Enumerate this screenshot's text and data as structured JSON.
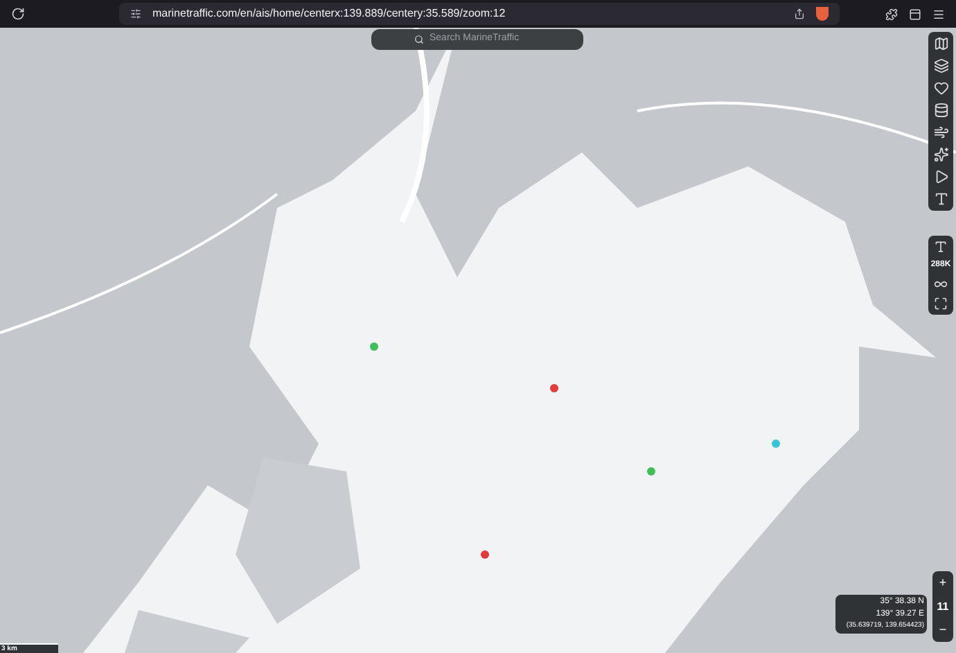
{
  "browser": {
    "url": "marinetraffic.com/en/ais/home/centerx:139.889/centery:35.589/zoom:12"
  },
  "map": {
    "kind": "picture",
    "search": {
      "placeholder": "Search MarineTraffic"
    },
    "vessel_count": "288K",
    "coordinates": {
      "lat": "35° 38.38 N",
      "lon": "139° 39.27 E",
      "decimal": "(35.639719, 139.654423)"
    },
    "zoom": {
      "plus": "+",
      "level": "11",
      "minus": "−"
    },
    "scale": "3 km"
  }
}
